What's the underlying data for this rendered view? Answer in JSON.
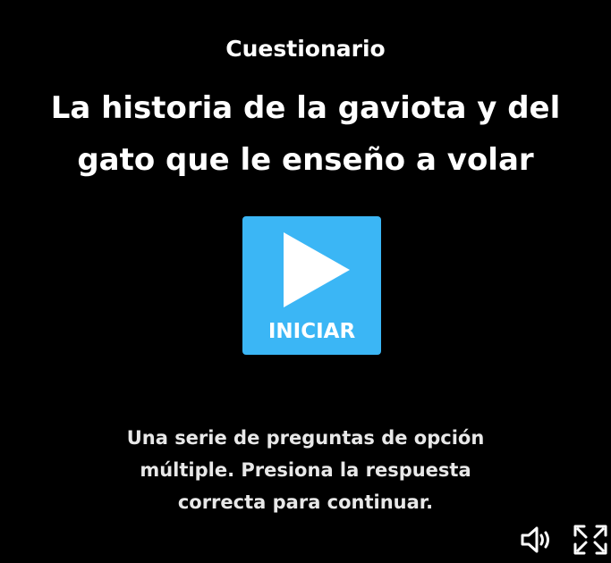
{
  "quiz": {
    "eyebrow": "Cuestionario",
    "title": "La historia de la gaviota y del gato que le enseño a volar",
    "start_label": "INICIAR",
    "description": "Una serie de preguntas de opción múltiple. Presiona la respuesta correcta para continuar."
  },
  "controls": {
    "volume_icon": "speaker-volume-icon",
    "fullscreen_icon": "fullscreen-expand-icon"
  },
  "colors": {
    "background": "#000000",
    "start_button": "#3bb6f5",
    "text": "#ffffff",
    "description_text": "#e8e8e8"
  }
}
